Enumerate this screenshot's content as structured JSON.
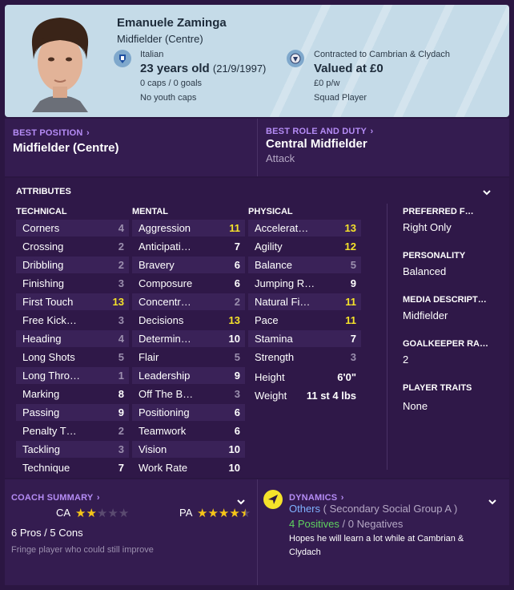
{
  "header": {
    "name": "Emanuele Zaminga",
    "position": "Midfielder (Centre)",
    "nationality": "Italian",
    "age": "23 years old",
    "dob": "(21/9/1997)",
    "caps": "0 caps / 0 goals",
    "youth_caps": "No youth caps",
    "contract": "Contracted to Cambrian & Clydach",
    "value": "Valued at £0",
    "wage": "£0 p/w",
    "status": "Squad Player"
  },
  "best_position": {
    "label": "BEST POSITION",
    "value": "Midfielder (Centre)"
  },
  "best_role": {
    "label": "BEST ROLE AND DUTY",
    "value": "Central Midfielder",
    "duty": "Attack"
  },
  "attributes": {
    "title": "ATTRIBUTES",
    "technical": {
      "title": "TECHNICAL",
      "rows": [
        {
          "name": "Corners",
          "value": "4"
        },
        {
          "name": "Crossing",
          "value": "2"
        },
        {
          "name": "Dribbling",
          "value": "2"
        },
        {
          "name": "Finishing",
          "value": "3"
        },
        {
          "name": "First Touch",
          "value": "13"
        },
        {
          "name": "Free Kick…",
          "value": "3"
        },
        {
          "name": "Heading",
          "value": "4"
        },
        {
          "name": "Long Shots",
          "value": "5"
        },
        {
          "name": "Long Thro…",
          "value": "1"
        },
        {
          "name": "Marking",
          "value": "8"
        },
        {
          "name": "Passing",
          "value": "9"
        },
        {
          "name": "Penalty T…",
          "value": "2"
        },
        {
          "name": "Tackling",
          "value": "3"
        },
        {
          "name": "Technique",
          "value": "7"
        }
      ]
    },
    "mental": {
      "title": "MENTAL",
      "rows": [
        {
          "name": "Aggression",
          "value": "11"
        },
        {
          "name": "Anticipati…",
          "value": "7"
        },
        {
          "name": "Bravery",
          "value": "6"
        },
        {
          "name": "Composure",
          "value": "6"
        },
        {
          "name": "Concentr…",
          "value": "2"
        },
        {
          "name": "Decisions",
          "value": "13"
        },
        {
          "name": "Determin…",
          "value": "10"
        },
        {
          "name": "Flair",
          "value": "5"
        },
        {
          "name": "Leadership",
          "value": "9"
        },
        {
          "name": "Off The B…",
          "value": "3"
        },
        {
          "name": "Positioning",
          "value": "6"
        },
        {
          "name": "Teamwork",
          "value": "6"
        },
        {
          "name": "Vision",
          "value": "10"
        },
        {
          "name": "Work Rate",
          "value": "10"
        }
      ]
    },
    "physical": {
      "title": "PHYSICAL",
      "rows": [
        {
          "name": "Accelerat…",
          "value": "13"
        },
        {
          "name": "Agility",
          "value": "12"
        },
        {
          "name": "Balance",
          "value": "5"
        },
        {
          "name": "Jumping R…",
          "value": "9"
        },
        {
          "name": "Natural Fi…",
          "value": "11"
        },
        {
          "name": "Pace",
          "value": "11"
        },
        {
          "name": "Stamina",
          "value": "7"
        },
        {
          "name": "Strength",
          "value": "3"
        }
      ],
      "height_label": "Height",
      "height": "6'0\"",
      "weight_label": "Weight",
      "weight": "11 st 4 lbs"
    }
  },
  "side": {
    "preferred_foot_label": "PREFERRED F…",
    "preferred_foot": "Right Only",
    "personality_label": "PERSONALITY",
    "personality": "Balanced",
    "media_label": "MEDIA DESCRIPT…",
    "media": "Midfielder",
    "gk_label": "GOALKEEPER RA…",
    "gk": "2",
    "traits_label": "PLAYER TRAITS",
    "traits": "None"
  },
  "coach": {
    "label": "COACH SUMMARY",
    "ca_label": "CA",
    "ca_stars": 2,
    "pa_label": "PA",
    "pa_stars": 4.5,
    "pros_cons": "6 Pros / 5 Cons",
    "summary": "Fringe player who could still improve"
  },
  "dynamics": {
    "label": "DYNAMICS",
    "group_name": "Others",
    "group_desc": "( Secondary Social Group A )",
    "positives": "4 Positives",
    "separator": "/",
    "negatives": "0 Negatives",
    "hope": "Hopes he will learn a lot while at Cambrian & Clydach"
  },
  "colors": {
    "accent": "#b58cf5",
    "highlight": "#f5e22a",
    "positive": "#5fd35f",
    "link": "#7fb2ff"
  }
}
